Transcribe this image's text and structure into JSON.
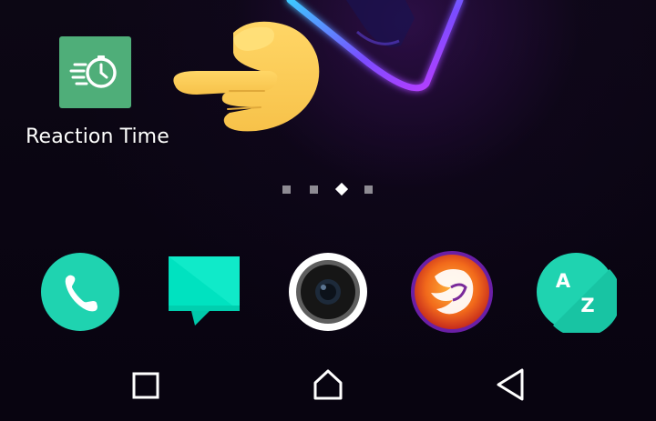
{
  "home_screen": {
    "page_count": 4,
    "active_page_index": 2
  },
  "apps": {
    "reaction_time": {
      "label": "Reaction Time",
      "icon": "stopwatch-speed-icon",
      "tile_color": "#4fae79"
    }
  },
  "dock": [
    {
      "name": "phone",
      "icon": "phone-icon",
      "color": "#1fd3b0"
    },
    {
      "name": "messages",
      "icon": "message-bubble-icon",
      "color": "#00e2c0"
    },
    {
      "name": "camera",
      "icon": "camera-lens-icon",
      "color": "#ffffff"
    },
    {
      "name": "browser",
      "icon": "phoenix-browser-icon",
      "color": "#f26a1b"
    },
    {
      "name": "app-drawer",
      "icon": "a-z-icon",
      "color": "#1fd3b0"
    }
  ],
  "app_drawer_letters": {
    "top": "A",
    "bottom": "Z"
  },
  "navigation": {
    "recents_icon": "square-icon",
    "home_icon": "home-icon",
    "back_icon": "back-triangle-icon"
  },
  "decorations": {
    "pointing_hand": "pointing-right-hand-icon",
    "hand_color": "#ffd160",
    "neon_colors": [
      "#3ec8ff",
      "#7a4dff",
      "#c13bff"
    ]
  }
}
